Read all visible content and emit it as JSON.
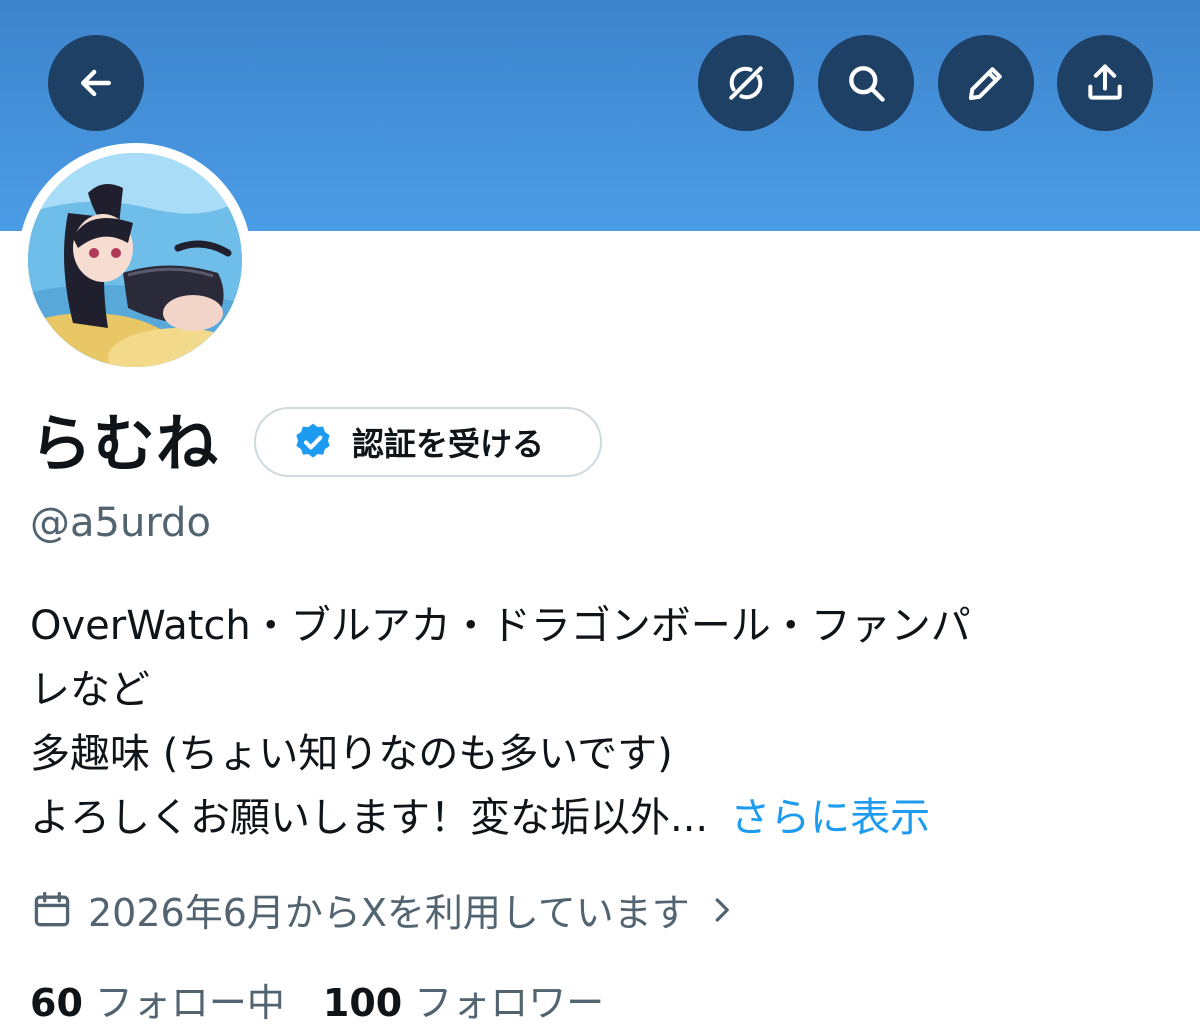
{
  "header": {
    "back_icon": "arrow-left-icon",
    "actions": [
      "grok-icon",
      "search-icon",
      "pencil-icon",
      "share-icon"
    ],
    "banner_color": "#4b9ce6",
    "button_color": "#1e4064"
  },
  "profile": {
    "display_name": "らむね",
    "verify_button_label": "認証を受ける",
    "verify_icon": "verified-badge-icon",
    "handle": "@a5urdo",
    "bio_lines": [
      "OverWatch・ブルアカ・ドラゴンボール・ファンパ",
      "レなど",
      "多趣味 (ちょい知りなのも多いです)",
      "よろしくお願いします！変な垢以外..."
    ],
    "show_more_label": "さらに表示",
    "joined_text": "2026年6月からXを利用しています",
    "joined_icon": "calendar-icon",
    "following_count": "60",
    "following_label": "フォロー中",
    "followers_count": "100",
    "followers_label": "フォロワー",
    "accent_color": "#1d9bf0"
  }
}
